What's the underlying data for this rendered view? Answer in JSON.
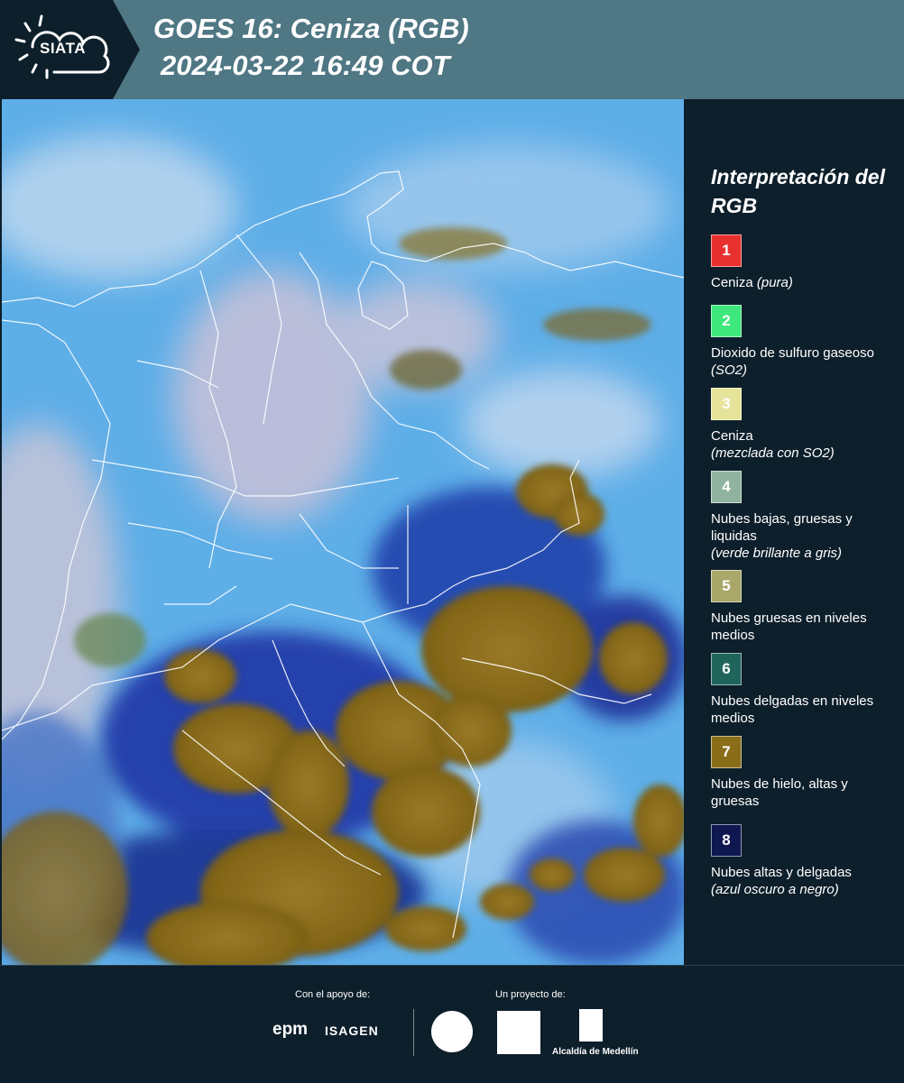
{
  "header": {
    "logo_text": "SIATA",
    "title": "GOES 16: Ceniza (RGB)",
    "datetime": "2024-03-22 16:49 COT"
  },
  "map": {
    "product": "Ceniza (RGB)"
  },
  "legend": {
    "title": "Interpretación del RGB",
    "items": [
      {
        "number": "1",
        "color": "#e8312f",
        "label": "Ceniza",
        "note": "(pura)"
      },
      {
        "number": "2",
        "color": "#3ee87c",
        "label": "Dioxido de sulfuro gaseoso",
        "note": "(SO2)"
      },
      {
        "number": "3",
        "color": "#e6e39a",
        "label": "Ceniza",
        "note": "(mezclada con SO2)"
      },
      {
        "number": "4",
        "color": "#8fb39e",
        "label": "Nubes bajas, gruesas y liquidas",
        "note": "(verde brillante a gris)"
      },
      {
        "number": "5",
        "color": "#a9a76a",
        "label": "Nubes gruesas en niveles medios",
        "note": ""
      },
      {
        "number": "6",
        "color": "#20655b",
        "label": "Nubes delgadas en niveles medios",
        "note": ""
      },
      {
        "number": "7",
        "color": "#8a6d18",
        "label": "Nubes de hielo, altas y gruesas",
        "note": ""
      },
      {
        "number": "8",
        "color": "#0e1750",
        "label": "Nubes altas y delgadas",
        "note": "(azul oscuro a negro)"
      }
    ]
  },
  "footer": {
    "support_label": "Con el apoyo de:",
    "project_label": "Un proyecto de:",
    "sponsor_1": "epm",
    "sponsor_2": "ISAGEN",
    "partner_3": "Alcaldía de Medellín"
  }
}
